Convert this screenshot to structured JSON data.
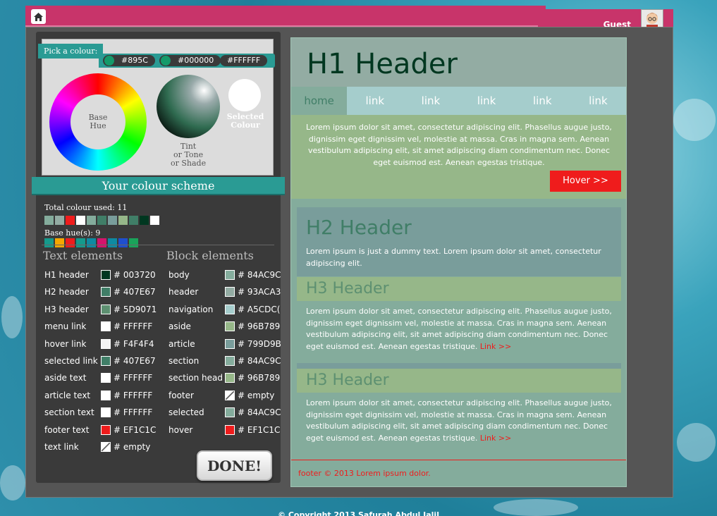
{
  "user": {
    "name": "Guest"
  },
  "picker": {
    "label": "Pick a colour:",
    "hex_base": "#895C",
    "hex_shade": "#000000",
    "hex_selected": "#FFFFFF",
    "base_label": "Base\nHue",
    "tint_label": "Tint\nor Tone\nor Shade",
    "selected_label": "Selected\nColour"
  },
  "scheme": {
    "title": "Your colour scheme",
    "total_label": "Total colour used: 11",
    "total_swatches": [
      "#84ac9c",
      "#93aca3",
      "#ef1c1c",
      "#ffffff",
      "#84ac9c",
      "#407e67",
      "#799d9b",
      "#96b789",
      "#407e67",
      "#003720",
      "#ffffff"
    ],
    "hue_label": "Base hue(s): 9",
    "hue_swatches": [
      "#159a8c",
      "#f5a700",
      "#ef1c1c",
      "#159a8c",
      "#0e8aa2",
      "#d4146c",
      "#0e8aa2",
      "#1f4fcf",
      "#1aa35a"
    ]
  },
  "text_elements": {
    "title": "Text elements",
    "rows": [
      {
        "name": "H1 header",
        "value": "# 003720",
        "color": "#003720"
      },
      {
        "name": "H2 header",
        "value": "# 407E67",
        "color": "#407e67"
      },
      {
        "name": "H3 header",
        "value": "# 5D9071",
        "color": "#5d9071"
      },
      {
        "name": "menu link",
        "value": "# FFFFFF",
        "color": "#ffffff"
      },
      {
        "name": "hover link",
        "value": "# F4F4F4",
        "color": "#f4f4f4"
      },
      {
        "name": "selected link",
        "value": "# 407E67",
        "color": "#407e67"
      },
      {
        "name": "aside text",
        "value": "# FFFFFF",
        "color": "#ffffff"
      },
      {
        "name": "article text",
        "value": "# FFFFFF",
        "color": "#ffffff"
      },
      {
        "name": "section text",
        "value": "# FFFFFF",
        "color": "#ffffff"
      },
      {
        "name": "footer text",
        "value": "# EF1C1C",
        "color": "#ef1c1c"
      },
      {
        "name": "text link",
        "value": "# empty",
        "color": ""
      }
    ]
  },
  "block_elements": {
    "title": "Block elements",
    "rows": [
      {
        "name": "body",
        "value": "# 84AC9C",
        "color": "#84ac9c"
      },
      {
        "name": "header",
        "value": "# 93ACA3",
        "color": "#93aca3"
      },
      {
        "name": "navigation",
        "value": "# A5CDC(",
        "color": "#a5cdcc"
      },
      {
        "name": "aside",
        "value": "# 96B789",
        "color": "#96b789"
      },
      {
        "name": "article",
        "value": "# 799D9B",
        "color": "#799d9b"
      },
      {
        "name": "section",
        "value": "# 84AC9C",
        "color": "#84ac9c"
      },
      {
        "name": "section head",
        "value": "# 96B789",
        "color": "#96b789"
      },
      {
        "name": "footer",
        "value": "# empty",
        "color": ""
      },
      {
        "name": "selected",
        "value": "# 84AC9C",
        "color": "#84ac9c"
      },
      {
        "name": "hover",
        "value": "# EF1C1C",
        "color": "#ef1c1c"
      }
    ]
  },
  "done_label": "DONE!",
  "preview": {
    "h1": "H1 Header",
    "nav": [
      "home",
      "link",
      "link",
      "link",
      "link",
      "link"
    ],
    "aside_text": "Lorem ipsum dolor sit amet, consectetur adipiscing elit. Phasellus augue justo, dignissim eget dignissim vel, molestie at massa. Cras in magna sem. Aenean vestibulum adipiscing elit, sit amet adipiscing diam condimentum nec. Donec eget euismod est. Aenean egestas tristique.",
    "hover_label": "Hover >>",
    "h2": "H2 Header",
    "article_text": "Lorem ipsum is just a dummy text. Lorem ipsum dolor sit amet, consectetur adipiscing elit.",
    "sections": [
      {
        "h3": "H3 Header",
        "text": "Lorem ipsum dolor sit amet, consectetur adipiscing elit. Phasellus augue justo, dignissim eget dignissim vel, molestie at massa. Cras in magna sem. Aenean vestibulum adipiscing elit, sit amet adipiscing diam condimentum nec. Donec eget euismod est. Aenean egestas tristique.",
        "link": "Link >>"
      },
      {
        "h3": "H3 Header",
        "text": "Lorem ipsum dolor sit amet, consectetur adipiscing elit. Phasellus augue justo, dignissim eget dignissim vel, molestie at massa. Cras in magna sem. Aenean vestibulum adipiscing elit, sit amet adipiscing diam condimentum nec. Donec eget euismod est. Aenean egestas tristique.",
        "link": "Link >>"
      }
    ],
    "footer": "footer © 2013 Lorem ipsum dolor."
  },
  "copyright": "© Copyright 2013 Safurah Abdul Jalil",
  "icons": {
    "home": "home-icon",
    "avatar": "user-avatar-icon"
  }
}
